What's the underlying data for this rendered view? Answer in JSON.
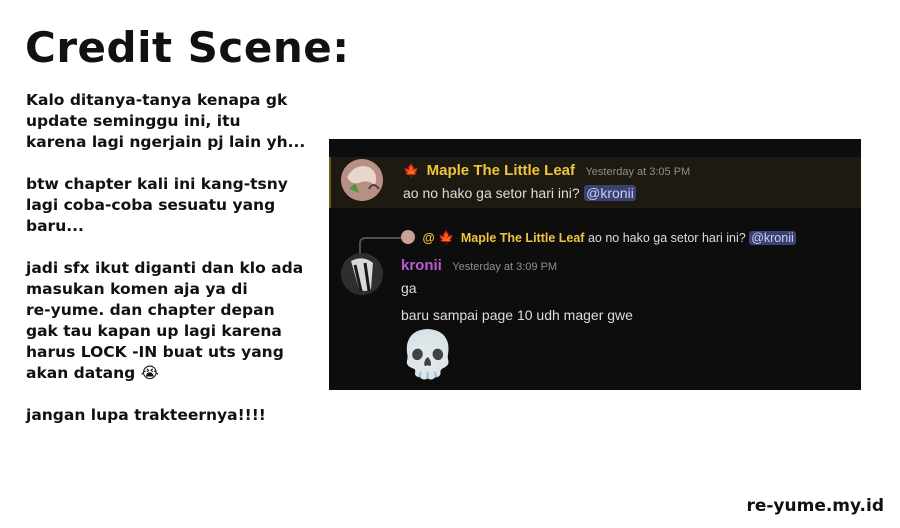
{
  "title": "Credit Scene:",
  "notes": [
    "Kalo ditanya-tanya kenapa gk\nupdate seminggu ini, itu\nkarena lagi ngerjain pj lain yh...",
    "btw chapter kali ini kang-tsny\nlagi coba-coba sesuatu yang\nbaru...",
    "jadi sfx ikut diganti dan klo ada\nmasukan komen aja ya di\nre-yume. dan chapter depan\ngak tau kapan up lagi karena\nharus LOCK -IN buat uts yang\nakan datang 😭",
    "jangan lupa trakteernya!!!!"
  ],
  "footer": "re-yume.my.id",
  "chat": {
    "leaf_icon": "🍁",
    "message1": {
      "author": "Maple The Little Leaf",
      "timestamp": "Yesterday at 3:05 PM",
      "text": "ao no hako ga setor hari ini?",
      "mention": "@kronii"
    },
    "reply": {
      "at": "@",
      "author": "Maple The Little Leaf",
      "text": "ao no hako ga setor hari ini?",
      "mention": "@kronii"
    },
    "message2": {
      "author": "kronii",
      "timestamp": "Yesterday at 3:09 PM",
      "line1": "ga",
      "line2": "baru sampai page 10 udh mager gwe",
      "emoji": "💀"
    },
    "colors": {
      "background": "#0d0d0e",
      "maple_name": "#f0c53c",
      "kronii_name": "#b95ad6",
      "mention_bg": "#3c4270",
      "highlight_bg": "#1d1a12"
    }
  }
}
